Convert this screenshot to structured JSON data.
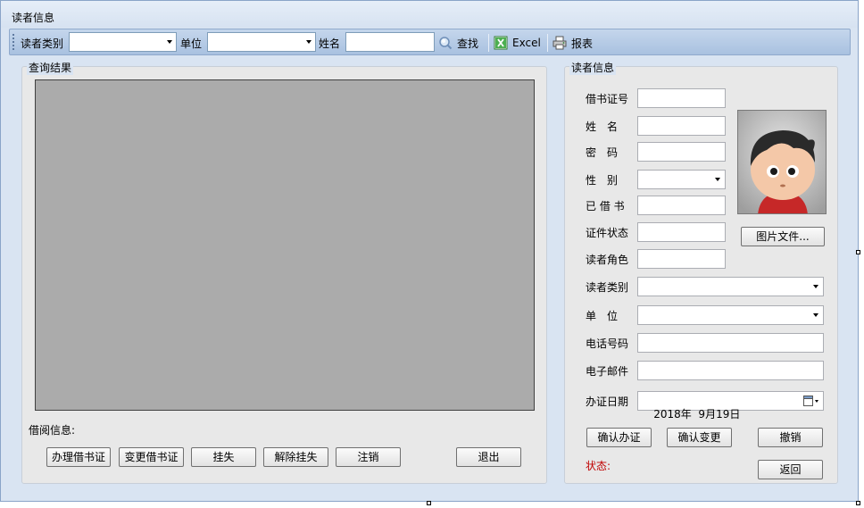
{
  "window": {
    "title": "读者信息"
  },
  "toolbar": {
    "reader_type_label": "读者类别",
    "reader_type_value": "",
    "unit_label": "单位",
    "unit_value": "",
    "name_label": "姓名",
    "name_value": "",
    "search_label": "查找",
    "excel_label": "Excel",
    "report_label": "报表"
  },
  "results": {
    "group_title": "查询结果",
    "borrow_info_label": "借阅信息:",
    "buttons": {
      "issue_card": "办理借书证",
      "change_card": "变更借书证",
      "report_loss": "挂失",
      "cancel_loss": "解除挂失",
      "deregister": "注销",
      "exit": "退出"
    }
  },
  "reader": {
    "group_title": "读者信息",
    "labels": {
      "card_no": "借书证号",
      "name": "姓　名",
      "password": "密　码",
      "gender": "性　别",
      "borrowed": "已 借 书",
      "card_status": "证件状态",
      "reader_role": "读者角色",
      "reader_type": "读者类别",
      "unit": "单　位",
      "phone": "电话号码",
      "email": "电子邮件",
      "issue_date": "办证日期"
    },
    "values": {
      "card_no": "",
      "name": "",
      "password": "",
      "gender": "",
      "borrowed": "",
      "card_status": "",
      "reader_role": "",
      "reader_type": "",
      "unit": "",
      "phone": "",
      "email": "",
      "issue_date": "2018年  9月19日"
    },
    "picture_button": "图片文件...",
    "confirm_issue_button": "确认办证",
    "confirm_change_button": "确认变更",
    "undo_button": "撤销",
    "back_button": "返回",
    "status_label": "状态:"
  },
  "icons": {
    "search": "magnifier-icon",
    "excel": "excel-icon",
    "report": "printer-icon",
    "calendar": "calendar-icon"
  },
  "colors": {
    "toolbar": "#b4c9e6",
    "grid_background": "#ababab",
    "status_text": "#c00000",
    "window_background": "#d9e4f2"
  }
}
